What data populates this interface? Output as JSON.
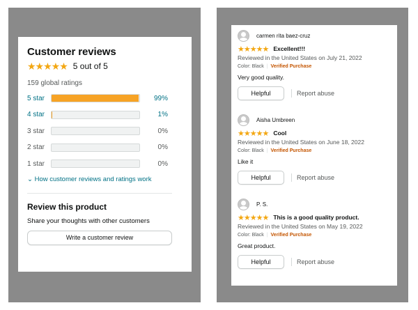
{
  "summary": {
    "title": "Customer reviews",
    "stars": "★★★★★",
    "rating_text": "5 out of 5",
    "global_ratings": "159 global ratings",
    "histogram": [
      {
        "label": "5 star",
        "percent": "99%",
        "fill": 0.99
      },
      {
        "label": "4 star",
        "percent": "1%",
        "fill": 0.01
      },
      {
        "label": "3 star",
        "percent": "0%",
        "fill": 0
      },
      {
        "label": "2 star",
        "percent": "0%",
        "fill": 0
      },
      {
        "label": "1 star",
        "percent": "0%",
        "fill": 0
      }
    ],
    "how_link": "How customer reviews and ratings work",
    "how_icon": "chevron-down-icon",
    "review_heading": "Review this product",
    "share_text": "Share your thoughts with other customers",
    "write_button": "Write a customer review"
  },
  "reviews": [
    {
      "reviewer": "carmen rita baez-cruz",
      "stars": "★★★★★",
      "title": "Excellent!!!",
      "meta": "Reviewed in the United States on July 21, 2022",
      "color": "Color: Black",
      "sep": "|",
      "verified": "Verified Purchase",
      "body": "Very good quality.",
      "helpful": "Helpful",
      "report": "Report abuse"
    },
    {
      "reviewer": "Aisha Umbreen",
      "stars": "★★★★★",
      "title": "Cool",
      "meta": "Reviewed in the United States on June 18, 2022",
      "color": "Color: Black",
      "sep": "|",
      "verified": "Verified Purchase",
      "body": "Like it",
      "helpful": "Helpful",
      "report": "Report abuse"
    },
    {
      "reviewer": "P. S.",
      "stars": "★★★★★",
      "title": "This is a good quality product.",
      "meta": "Reviewed in the United States on May 19, 2022",
      "color": "Color: Black",
      "sep": "|",
      "verified": "Verified Purchase",
      "body": "Great product.",
      "helpful": "Helpful",
      "report": "Report abuse"
    }
  ],
  "colors": {
    "star": "#f3a712",
    "bar_fill": "#f7a325",
    "link": "#007185",
    "verified": "#c45500",
    "frame": "#8a8a8a"
  }
}
